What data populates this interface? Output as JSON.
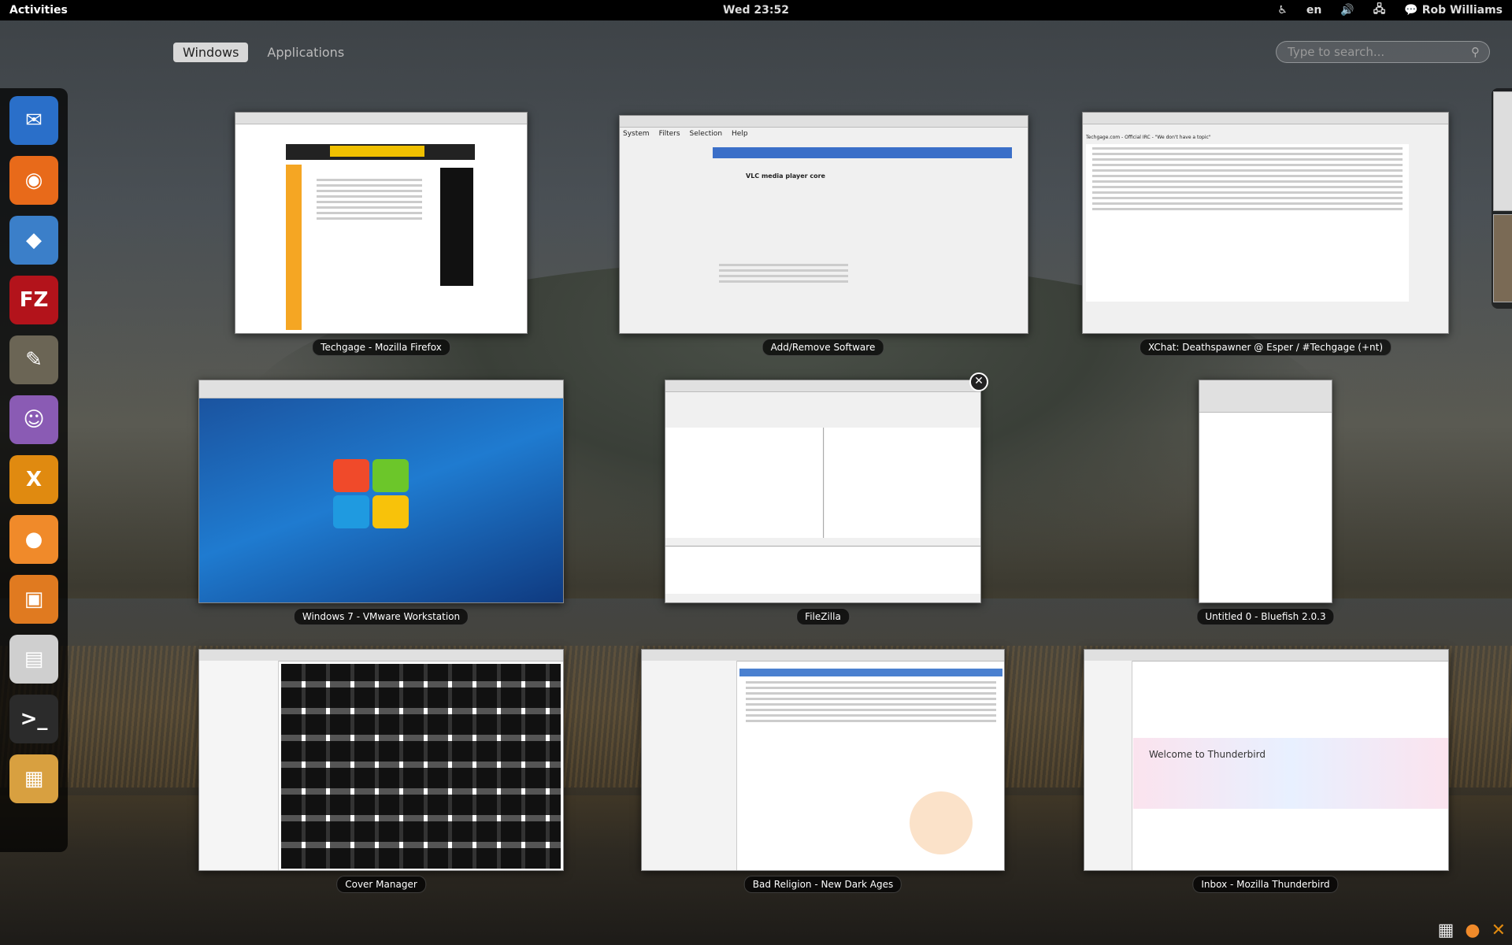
{
  "topbar": {
    "activities": "Activities",
    "clock": "Wed 23:52",
    "language": "en",
    "user": "Rob Williams"
  },
  "tabs": [
    {
      "label": "Windows",
      "active": true
    },
    {
      "label": "Applications",
      "active": false
    }
  ],
  "search": {
    "placeholder": "Type to search..."
  },
  "dash": [
    {
      "name": "thunderbird",
      "icon": "bird-icon",
      "glyph": "✉",
      "color": "#2a6fc9"
    },
    {
      "name": "firefox",
      "icon": "fox-icon",
      "glyph": "◉",
      "color": "#e86a1a"
    },
    {
      "name": "pidgin-bird",
      "icon": "bluebird-icon",
      "glyph": "◆",
      "color": "#3b7fc9"
    },
    {
      "name": "filezilla",
      "icon": "filezilla-icon",
      "glyph": "FZ",
      "color": "#b3131b"
    },
    {
      "name": "gimp",
      "icon": "gimp-icon",
      "glyph": "✎",
      "color": "#6b6555"
    },
    {
      "name": "pidgin",
      "icon": "chat-bubble-icon",
      "glyph": "☺",
      "color": "#8a5bb4"
    },
    {
      "name": "xchat",
      "icon": "xchat-icon",
      "glyph": "X",
      "color": "#e08a10"
    },
    {
      "name": "clementine",
      "icon": "orange-icon",
      "glyph": "●",
      "color": "#f08a2a"
    },
    {
      "name": "vmware",
      "icon": "vmware-icon",
      "glyph": "▣",
      "color": "#e07a20"
    },
    {
      "name": "files",
      "icon": "file-cabinet-icon",
      "glyph": "▤",
      "color": "#cfcfcf"
    },
    {
      "name": "terminal",
      "icon": "terminal-icon",
      "glyph": ">_",
      "color": "#2b2b2b"
    },
    {
      "name": "archive",
      "icon": "boxes-icon",
      "glyph": "▦",
      "color": "#d8a040"
    }
  ],
  "windows": [
    {
      "title": "Techgage - Mozilla Firefox"
    },
    {
      "title": "Add/Remove Software"
    },
    {
      "title": "XChat: Deathspawner @ Esper / #Techgage (+nt)"
    },
    {
      "title": "Windows 7 - VMware Workstation"
    },
    {
      "title": "FileZilla"
    },
    {
      "title": "Untitled 0 - Bluefish 2.0.3"
    },
    {
      "title": "Cover Manager"
    },
    {
      "title": "Bad Religion - New Dark Ages"
    },
    {
      "title": "Inbox - Mozilla Thunderbird"
    }
  ],
  "close_glyph": "✕",
  "thumb_text": {
    "addremove_menu": [
      "System",
      "Filters",
      "Selection",
      "Help"
    ],
    "addremove_item": "VLC media player core",
    "xchat_topic": "Techgage.com - Official IRC - \"We don't have a topic\"",
    "thunderbird_welcome": "Welcome to Thunderbird"
  }
}
